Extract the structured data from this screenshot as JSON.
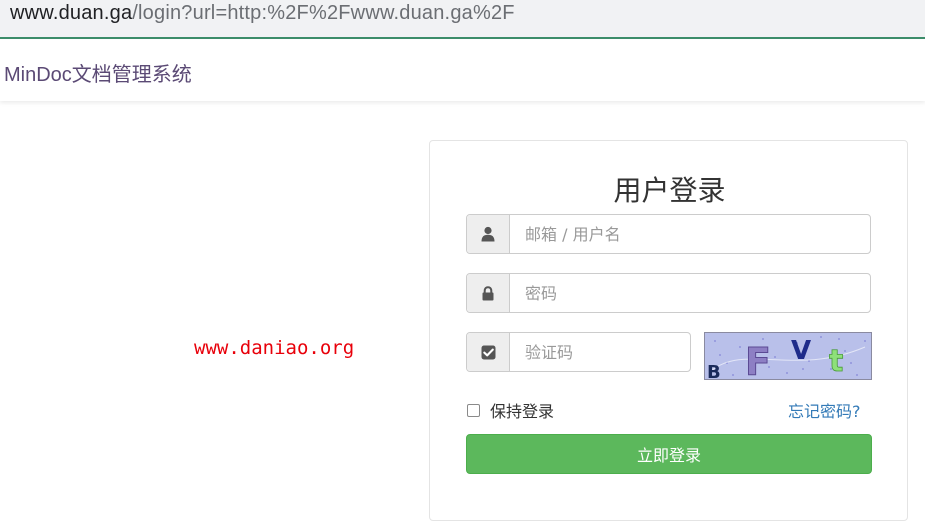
{
  "address_bar": {
    "host": "www.duan.ga",
    "path": "/login?url=http:%2F%2Fwww.duan.ga%2F"
  },
  "navbar": {
    "brand": "MinDoc文档管理系统"
  },
  "watermark": "www.daniao.org",
  "login": {
    "title": "用户登录",
    "account_placeholder": "邮箱 / 用户名",
    "account_icon": "user-icon",
    "password_placeholder": "密码",
    "password_icon": "lock-icon",
    "captcha_placeholder": "验证码",
    "captcha_icon": "check-square-icon",
    "remember_label": "保持登录",
    "forgot_label": "忘记密码?",
    "submit_label": "立即登录"
  },
  "colors": {
    "brand_text": "#5b4a75",
    "watermark": "#e8000a",
    "primary_button": "#5cb85c",
    "link": "#337ab7"
  }
}
